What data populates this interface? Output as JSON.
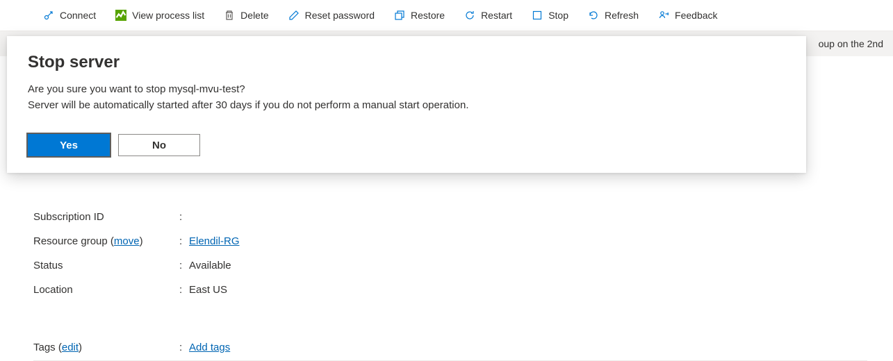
{
  "toolbar": {
    "connect": "Connect",
    "view_process": "View process list",
    "delete": "Delete",
    "reset_password": "Reset password",
    "restore": "Restore",
    "restart": "Restart",
    "stop": "Stop",
    "refresh": "Refresh",
    "feedback": "Feedback"
  },
  "banner": {
    "text": "oup on the 2nd"
  },
  "dialog": {
    "title": "Stop server",
    "line1": "Are you sure you want to stop mysql-mvu-test?",
    "line2": "Server will be automatically started after 30 days if you do not perform a manual start operation.",
    "yes": "Yes",
    "no": "No"
  },
  "details": {
    "subscription_id_label": "Subscription ID",
    "subscription_id_value": "",
    "resource_group_label": "Resource group",
    "resource_group_move": "move",
    "resource_group_value": "Elendil-RG",
    "status_label": "Status",
    "status_value": "Available",
    "location_label": "Location",
    "location_value": "East US",
    "tags_label": "Tags",
    "tags_edit": "edit",
    "tags_value": "Add tags"
  }
}
